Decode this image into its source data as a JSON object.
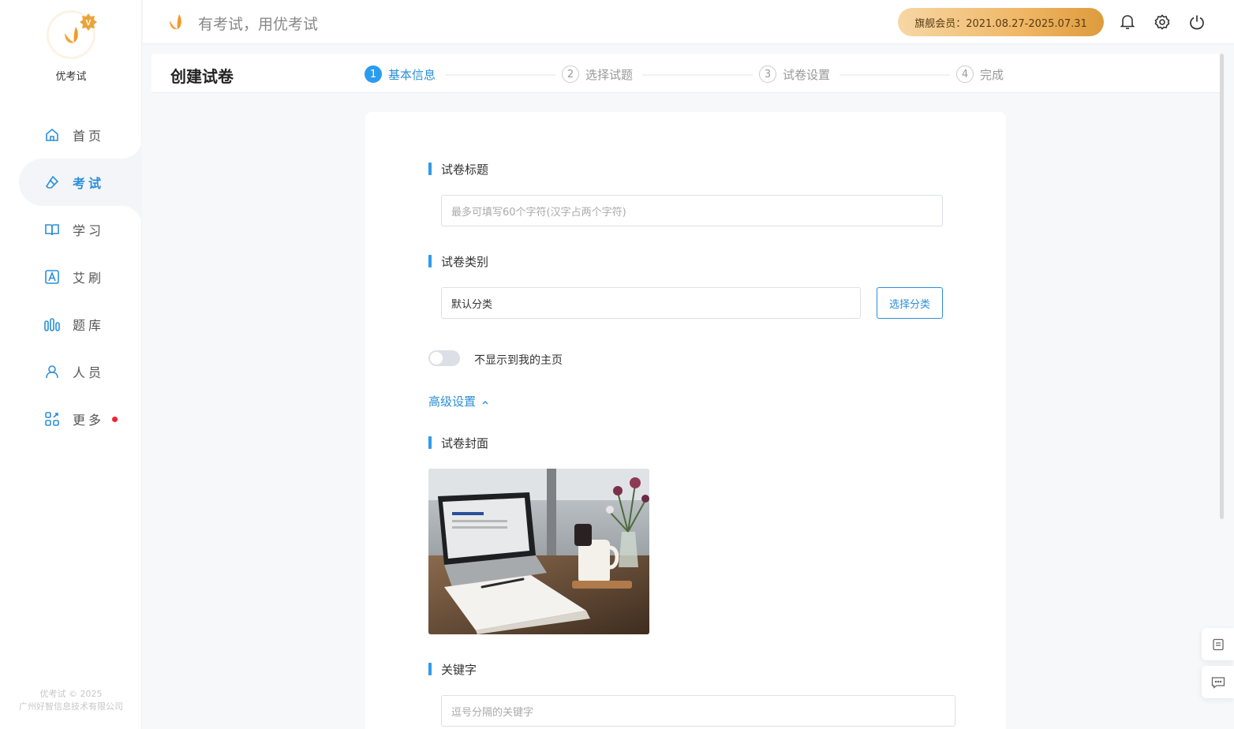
{
  "brand": {
    "name": "优考试",
    "slogan": "有考试，用优考试"
  },
  "sidebar": {
    "items": [
      {
        "label": "首页",
        "icon": "home-icon"
      },
      {
        "label": "考试",
        "icon": "eraser-icon",
        "active": true
      },
      {
        "label": "学习",
        "icon": "book-icon"
      },
      {
        "label": "艾刷",
        "icon": "letter-a-icon"
      },
      {
        "label": "题库",
        "icon": "bars-icon"
      },
      {
        "label": "人员",
        "icon": "user-icon"
      },
      {
        "label": "更多",
        "icon": "apps-icon",
        "badge_dot": true
      }
    ],
    "footer_line1": "优考试 © 2025",
    "footer_line2": "广州好智信息技术有限公司"
  },
  "header": {
    "vip_label": "旗舰会员：2021.08.27-2025.07.31",
    "icons": [
      "bell-icon",
      "gear-icon",
      "power-icon"
    ]
  },
  "page": {
    "title": "创建试卷",
    "steps": [
      {
        "num": "1",
        "label": "基本信息",
        "active": true
      },
      {
        "num": "2",
        "label": "选择试题"
      },
      {
        "num": "3",
        "label": "试卷设置"
      },
      {
        "num": "4",
        "label": "完成"
      }
    ]
  },
  "form": {
    "title_label": "试卷标题",
    "title_placeholder": "最多可填写60个字符(汉字占两个字符)",
    "category_label": "试卷类别",
    "category_value": "默认分类",
    "category_button": "选择分类",
    "hide_toggle_label": "不显示到我的主页",
    "hide_toggle_on": false,
    "advanced_label": "高级设置",
    "cover_label": "试卷封面",
    "keywords_label": "关键字",
    "keywords_placeholder": "逗号分隔的关键字"
  },
  "colors": {
    "accent": "#2b8fd8",
    "vip_gold": "#efb766",
    "brand_orange": "#f39a2b"
  }
}
